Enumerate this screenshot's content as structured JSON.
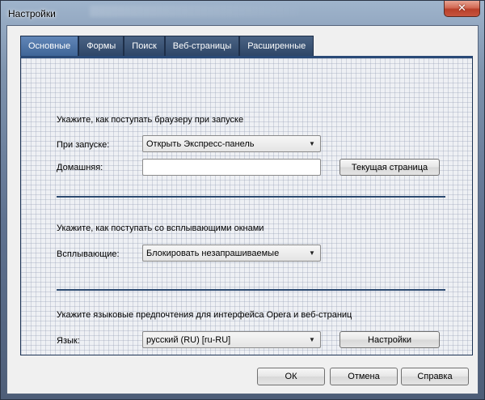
{
  "window": {
    "title": "Настройки",
    "close_glyph": "✕"
  },
  "tabs": [
    {
      "label": "Основные",
      "active": true
    },
    {
      "label": "Формы",
      "active": false
    },
    {
      "label": "Поиск",
      "active": false
    },
    {
      "label": "Веб-страницы",
      "active": false
    },
    {
      "label": "Расширенные",
      "active": false
    }
  ],
  "startup": {
    "heading": "Укажите, как поступать браузеру при запуске",
    "on_start_label": "При запуске:",
    "on_start_value": "Открыть Экспресс-панель",
    "home_label": "Домашняя:",
    "home_value": "",
    "current_page_button": "Текущая страница"
  },
  "popups": {
    "heading": "Укажите, как поступать со всплывающими окнами",
    "label": "Всплывающие:",
    "value": "Блокировать незапрашиваемые"
  },
  "language": {
    "heading": "Укажите языковые предпочтения для интерфейса Opera и веб-страниц",
    "label": "Язык:",
    "value": "русский (RU) [ru-RU]",
    "settings_button": "Настройки"
  },
  "footer": {
    "ok": "ОК",
    "cancel": "Отмена",
    "help": "Справка"
  },
  "icons": {
    "dropdown_arrow": "▼",
    "dropdown_icon_name": "chevron-down-icon"
  }
}
